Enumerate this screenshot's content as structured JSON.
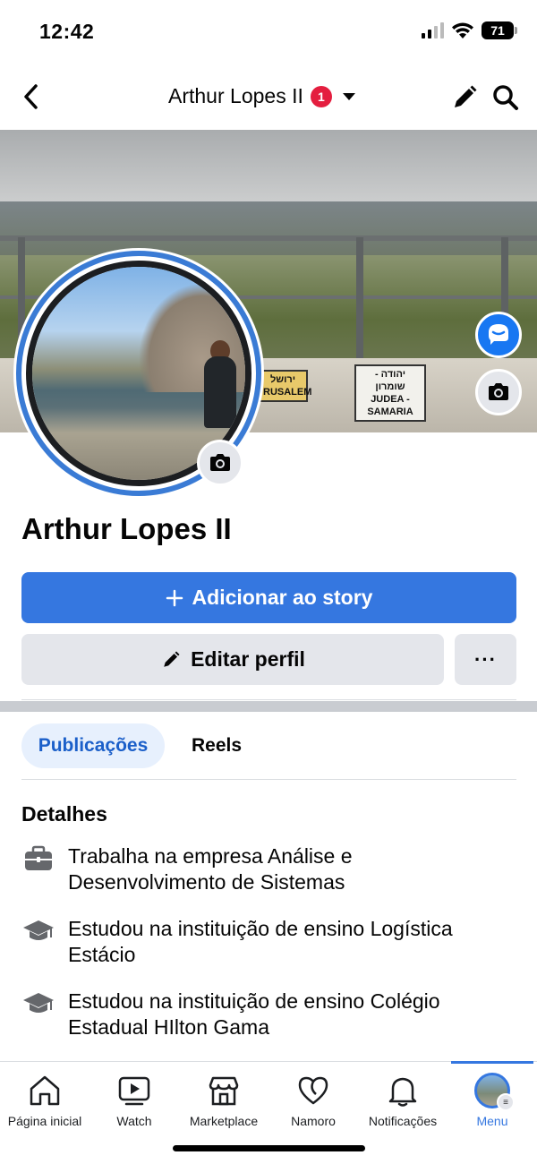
{
  "status_bar": {
    "time": "12:42",
    "battery": "71"
  },
  "header": {
    "title": "Arthur Lopes II",
    "badge_count": "1"
  },
  "cover": {
    "sign_left": "ירושל\nRUSALEM",
    "sign_right": "יהודה - שומרון\nJUDEA - SAMARIA"
  },
  "profile": {
    "name": "Arthur Lopes II",
    "add_story_label": "Adicionar ao story",
    "edit_profile_label": "Editar perfil",
    "more_label": "···"
  },
  "tabs": {
    "posts": "Publicações",
    "reels": "Reels"
  },
  "details": {
    "title": "Detalhes",
    "items": [
      {
        "icon": "briefcase-icon",
        "text": "Trabalha na empresa Análise e Desenvolvimento de Sistemas"
      },
      {
        "icon": "graduation-cap-icon",
        "text": "Estudou na instituição de ensino Logística Estácio"
      },
      {
        "icon": "graduation-cap-icon",
        "text": "Estudou na instituição de ensino Colégio Estadual HIlton Gama"
      }
    ]
  },
  "bottom_nav": {
    "items": [
      {
        "label": "Página inicial",
        "icon": "home-icon"
      },
      {
        "label": "Watch",
        "icon": "watch-icon"
      },
      {
        "label": "Marketplace",
        "icon": "marketplace-icon"
      },
      {
        "label": "Namoro",
        "icon": "dating-heart-icon"
      },
      {
        "label": "Notificações",
        "icon": "bell-icon"
      },
      {
        "label": "Menu",
        "icon": "menu-avatar-icon"
      }
    ],
    "active": "Menu"
  },
  "colors": {
    "accent": "#3577e0",
    "badge_red": "#e41e3f",
    "button_gray": "#e4e6eb"
  }
}
